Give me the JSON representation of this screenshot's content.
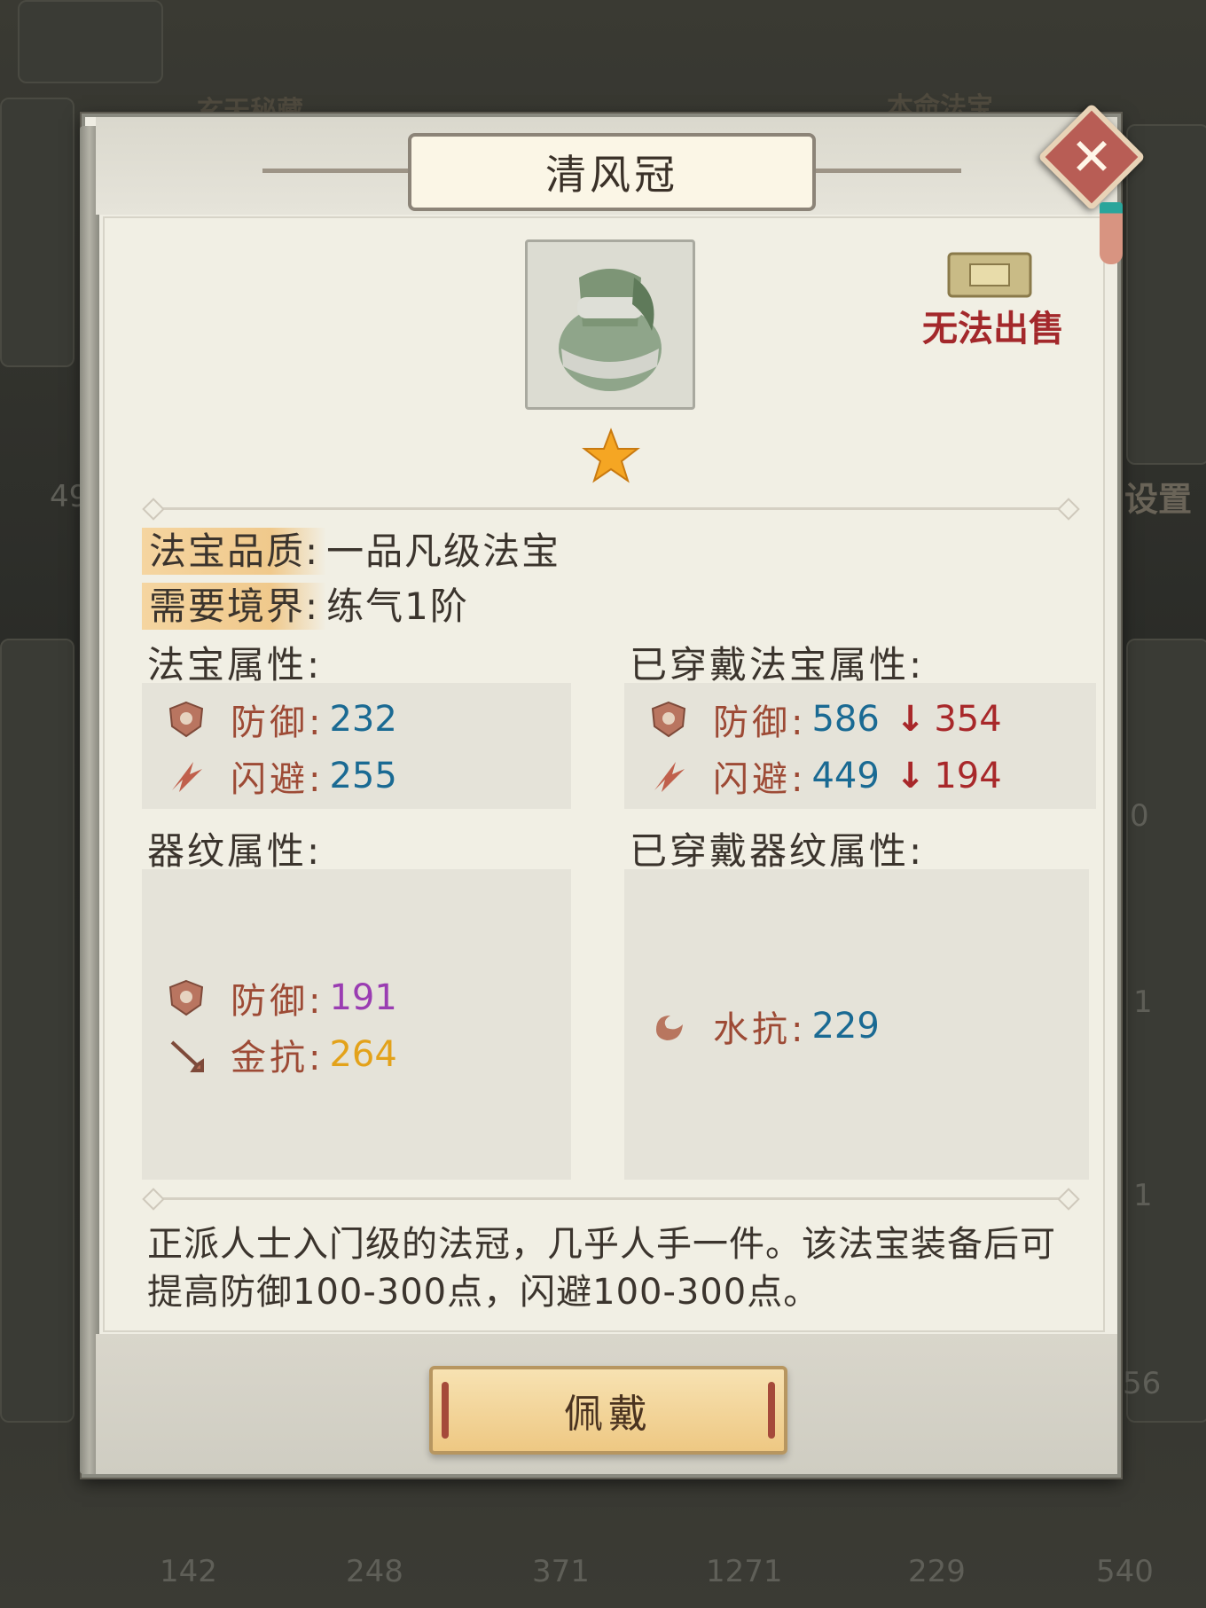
{
  "background": {
    "top_labels": [
      "玄天秘藏",
      "本命法宝"
    ],
    "right_label": "设置",
    "left_number": "49",
    "side_numbers": [
      "0",
      "1",
      "1",
      "56"
    ],
    "bottom_counts": [
      "142",
      "248",
      "371",
      "1271",
      "229",
      "540"
    ]
  },
  "dialog": {
    "title": "清风冠",
    "close_symbol": "✕",
    "item_icon": "green-cap-icon",
    "sell_status": "无法出售",
    "star_count": 1,
    "quality_label": "法宝品质:",
    "quality_value": "一品凡级法宝",
    "realm_label": "需要境界:",
    "realm_value": "练气1阶",
    "treasure_attr_title": "法宝属性:",
    "worn_treasure_attr_title": "已穿戴法宝属性:",
    "rune_attr_title": "器纹属性:",
    "worn_rune_attr_title": "已穿戴器纹属性:",
    "treasure_attrs": [
      {
        "icon": "defense-icon",
        "label": "防御:",
        "value": "232"
      },
      {
        "icon": "dodge-icon",
        "label": "闪避:",
        "value": "255"
      }
    ],
    "worn_treasure_attrs": [
      {
        "icon": "defense-icon",
        "label": "防御:",
        "value": "586",
        "arrow": "↓",
        "diff": "354"
      },
      {
        "icon": "dodge-icon",
        "label": "闪避:",
        "value": "449",
        "arrow": "↓",
        "diff": "194"
      }
    ],
    "rune_attrs": [
      {
        "icon": "defense-icon",
        "label": "防御:",
        "value": "191"
      },
      {
        "icon": "metal-resist-icon",
        "label": "金抗:",
        "value": "264"
      }
    ],
    "worn_rune_attrs": [
      {
        "icon": "water-resist-icon",
        "label": "水抗:",
        "value": "229"
      }
    ],
    "description": "正派人士入门级的法冠，几乎人手一件。该法宝装备后可提高防御100-300点，闪避100-300点。",
    "wear_button": "佩戴"
  }
}
